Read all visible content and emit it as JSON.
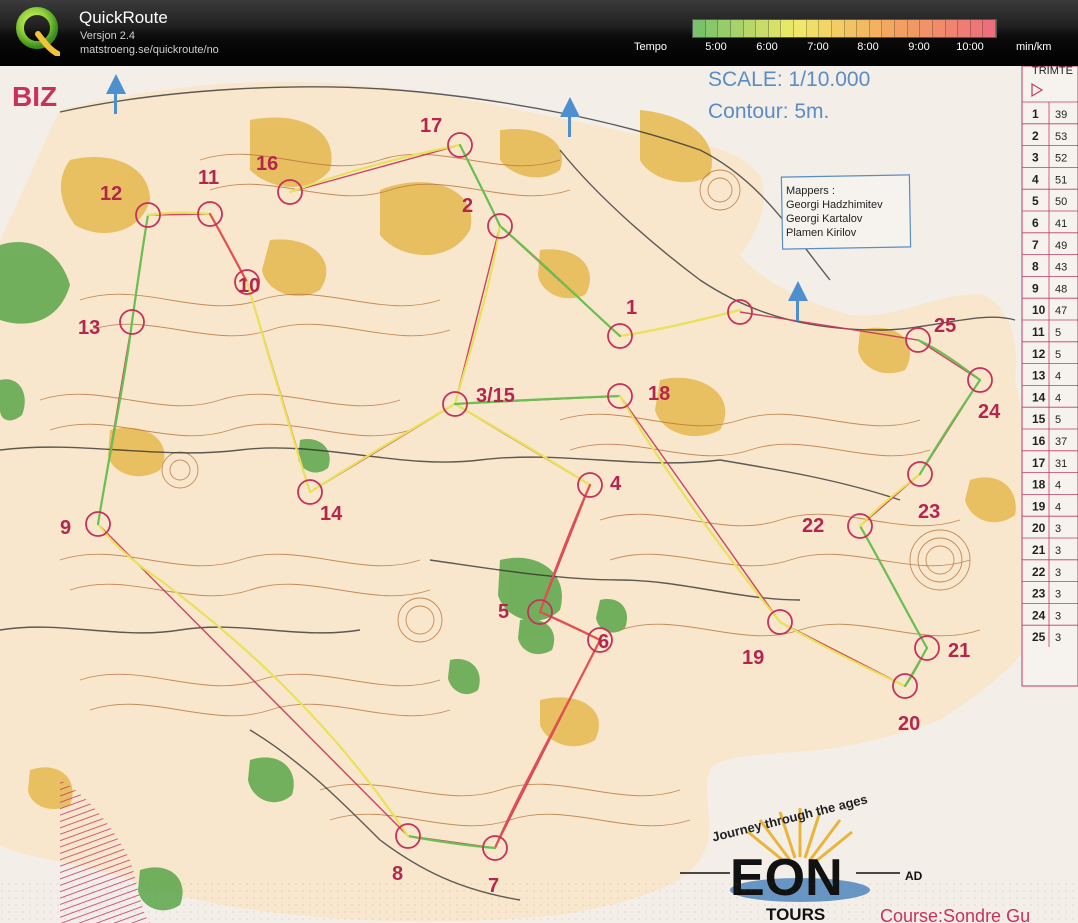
{
  "app": {
    "name": "QuickRoute",
    "version": "Versjon 2.4",
    "url": "matstroeng.se/quickroute/no"
  },
  "pace_legend": {
    "title": "Tempo",
    "unit": "min/km",
    "ticks": [
      "5:00",
      "6:00",
      "7:00",
      "8:00",
      "9:00",
      "10:00"
    ],
    "gradient_colors": [
      "#79c26b",
      "#f1ea6a",
      "#f3a55f",
      "#ec6f7b"
    ]
  },
  "map": {
    "header_fragment": "BIZ",
    "scale": "SCALE: 1/10.000",
    "contour": "Contour: 5m.",
    "mappers_title": "Mappers :",
    "mappers": [
      "Georgi Hadzhimitev",
      "Georgi Kartalov",
      "Plamen Kirilov"
    ],
    "logo_arc_text": "Journey through the ages",
    "logo_main": "EON",
    "logo_sub": "TOURS",
    "logo_suffix": "AD",
    "course_label": "Course:Sondre Gu",
    "table_header": "TRIMTE",
    "colors": {
      "paper": "#f4ecdf",
      "course": "#c7315a",
      "route_fast": "#6abf52",
      "route_medium": "#e9e15a",
      "route_slow": "#e2504f",
      "contour": "#b9743a",
      "yellow_area": "#e3b54a",
      "green_area": "#5aa64a"
    },
    "controls": [
      {
        "label": "1"
      },
      {
        "label": "2"
      },
      {
        "label": "3/15"
      },
      {
        "label": "4"
      },
      {
        "label": "5"
      },
      {
        "label": "6"
      },
      {
        "label": "7"
      },
      {
        "label": "8"
      },
      {
        "label": "9"
      },
      {
        "label": "10"
      },
      {
        "label": "11"
      },
      {
        "label": "12"
      },
      {
        "label": "13"
      },
      {
        "label": "14"
      },
      {
        "label": "16"
      },
      {
        "label": "17"
      },
      {
        "label": "18"
      },
      {
        "label": "19"
      },
      {
        "label": "20"
      },
      {
        "label": "21"
      },
      {
        "label": "22"
      },
      {
        "label": "23"
      },
      {
        "label": "24"
      },
      {
        "label": "25"
      }
    ],
    "table": {
      "rows": [
        [
          "1",
          "39"
        ],
        [
          "2",
          "53"
        ],
        [
          "3",
          "52"
        ],
        [
          "4",
          "51"
        ],
        [
          "5",
          "50"
        ],
        [
          "6",
          "41"
        ],
        [
          "7",
          "49"
        ],
        [
          "8",
          "43"
        ],
        [
          "9",
          "48"
        ],
        [
          "10",
          "47"
        ],
        [
          "11",
          "5"
        ],
        [
          "12",
          "5"
        ],
        [
          "13",
          "4"
        ],
        [
          "14",
          "4"
        ],
        [
          "15",
          "5"
        ],
        [
          "16",
          "37"
        ],
        [
          "17",
          "31"
        ],
        [
          "18",
          "4"
        ],
        [
          "19",
          "4"
        ],
        [
          "20",
          "3"
        ],
        [
          "21",
          "3"
        ],
        [
          "22",
          "3"
        ],
        [
          "23",
          "3"
        ],
        [
          "24",
          "3"
        ],
        [
          "25",
          "3"
        ]
      ]
    }
  }
}
